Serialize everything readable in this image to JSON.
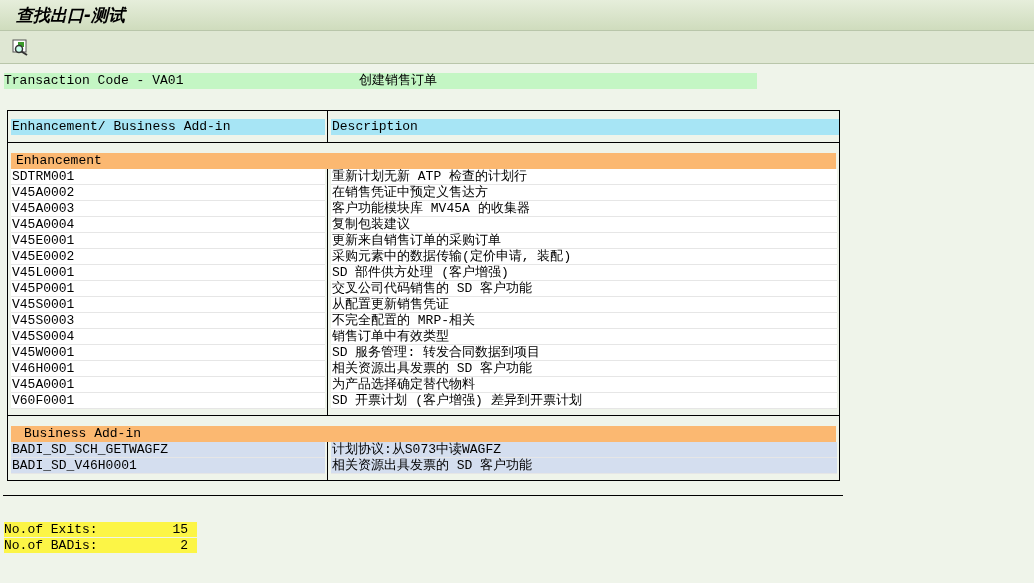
{
  "window": {
    "title": "查找出口-测试"
  },
  "transaction": {
    "label": "Transaction Code - VA01",
    "description": "创建销售订单"
  },
  "table": {
    "columns": [
      "Enhancement/ Business Add-in",
      "Description"
    ],
    "sections": [
      {
        "title": "Enhancement",
        "kind": "enhancement",
        "rows": [
          {
            "name": "SDTRM001",
            "description": "重新计划无新 ATP 检查的计划行"
          },
          {
            "name": "V45A0002",
            "description": "在销售凭证中预定义售达方"
          },
          {
            "name": "V45A0003",
            "description": "客户功能模块库 MV45A 的收集器"
          },
          {
            "name": "V45A0004",
            "description": "复制包装建议"
          },
          {
            "name": "V45E0001",
            "description": "更新来自销售订单的采购订单"
          },
          {
            "name": "V45E0002",
            "description": "采购元素中的数据传输(定价申请, 装配)"
          },
          {
            "name": "V45L0001",
            "description": "SD 部件供方处理 (客户增强)"
          },
          {
            "name": "V45P0001",
            "description": "交叉公司代码销售的 SD 客户功能"
          },
          {
            "name": "V45S0001",
            "description": "从配置更新销售凭证"
          },
          {
            "name": "V45S0003",
            "description": "不完全配置的 MRP-相关"
          },
          {
            "name": "V45S0004",
            "description": "销售订单中有效类型"
          },
          {
            "name": "V45W0001",
            "description": "SD 服务管理: 转发合同数据到项目"
          },
          {
            "name": "V46H0001",
            "description": "相关资源出具发票的 SD 客户功能"
          },
          {
            "name": "V45A0001",
            "description": "为产品选择确定替代物料"
          },
          {
            "name": "V60F0001",
            "description": "SD 开票计划 (客户增强) 差异到开票计划"
          }
        ]
      },
      {
        "title": "Business Add-in",
        "kind": "badi",
        "rows": [
          {
            "name": "BADI_SD_SCH_GETWAGFZ",
            "description": "计划协议:从S073中读WAGFZ"
          },
          {
            "name": "BADI_SD_V46H0001",
            "description": "相关资源出具发票的 SD 客户功能"
          }
        ]
      }
    ]
  },
  "summary": [
    {
      "label": "No.of Exits:",
      "value": "15"
    },
    {
      "label": "No.of BADis:",
      "value": "2"
    }
  ]
}
